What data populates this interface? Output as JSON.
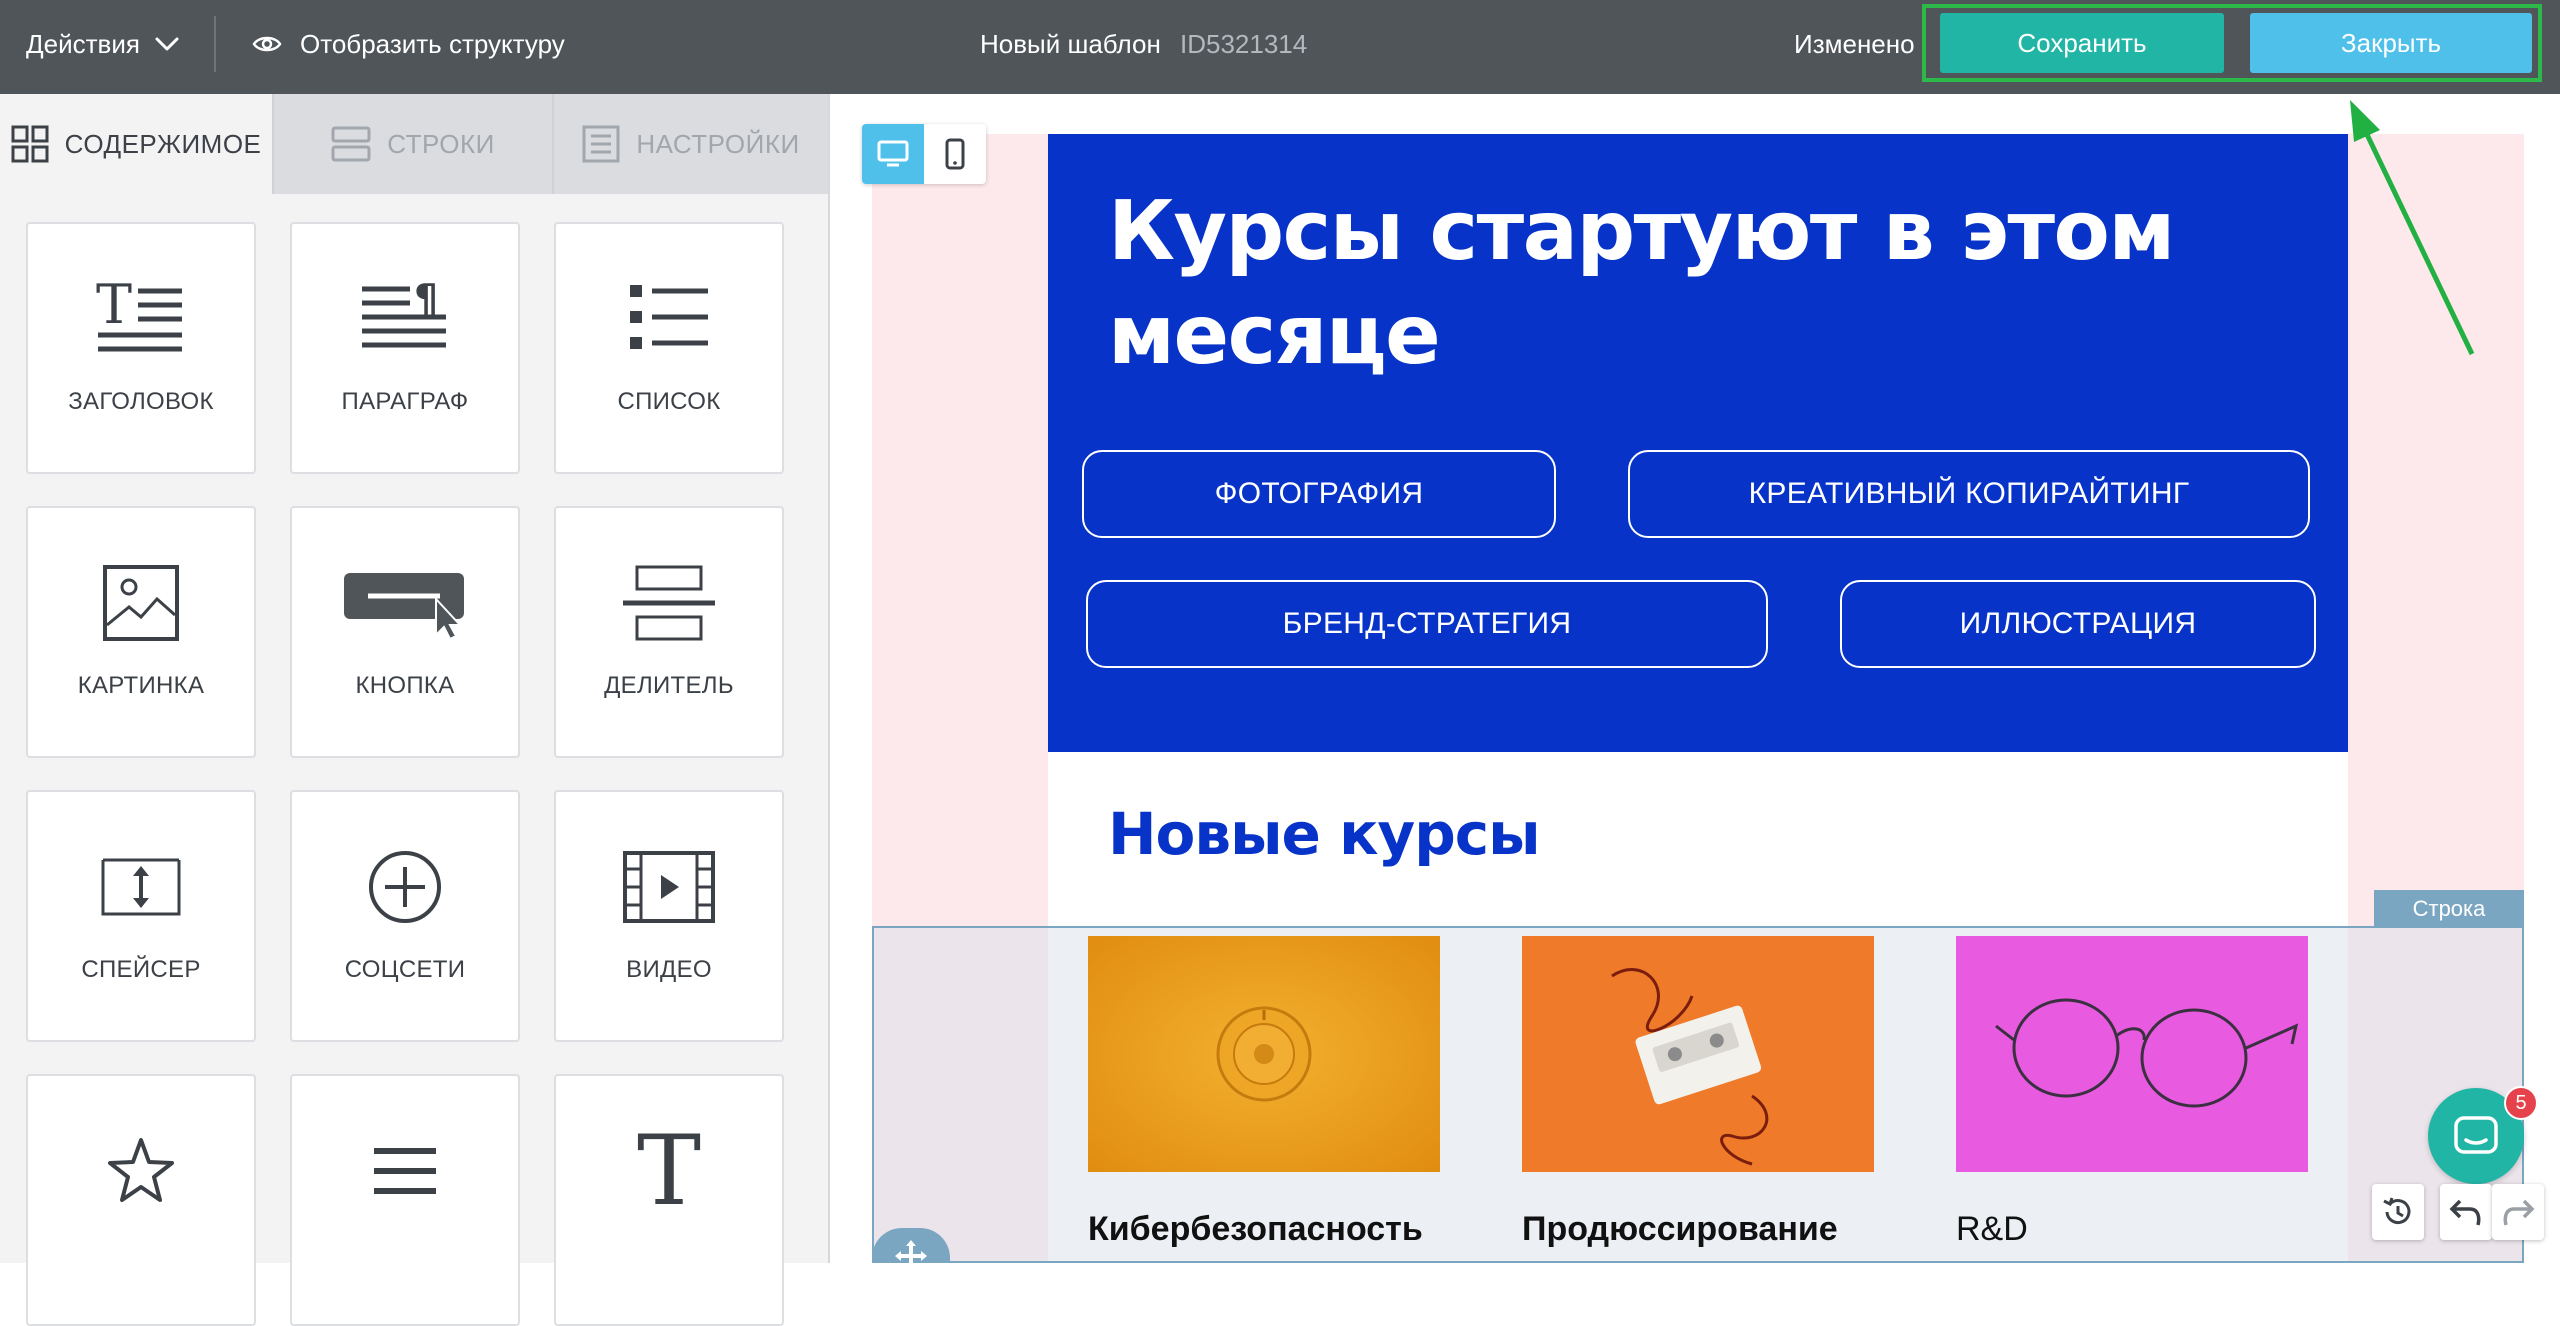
{
  "topbar": {
    "actions_label": "Действия",
    "structure_label": "Отобразить структуру",
    "template_name": "Новый шаблон",
    "template_id": "ID5321314",
    "status": "Изменено",
    "save_label": "Сохранить",
    "close_label": "Закрыть"
  },
  "tabs": {
    "content": "СОДЕРЖИМОЕ",
    "rows": "СТРОКИ",
    "settings": "НАСТРОЙКИ"
  },
  "blocks": [
    {
      "label": "ЗАГОЛОВОК",
      "icon": "heading-icon"
    },
    {
      "label": "ПАРАГРАФ",
      "icon": "paragraph-icon"
    },
    {
      "label": "СПИСОК",
      "icon": "list-icon"
    },
    {
      "label": "КАРТИНКА",
      "icon": "image-icon"
    },
    {
      "label": "КНОПКА",
      "icon": "button-icon"
    },
    {
      "label": "ДЕЛИТЕЛЬ",
      "icon": "divider-icon"
    },
    {
      "label": "СПЕЙСЕР",
      "icon": "spacer-icon"
    },
    {
      "label": "СОЦСЕТИ",
      "icon": "social-icon"
    },
    {
      "label": "ВИДЕО",
      "icon": "video-icon"
    },
    {
      "label": "",
      "icon": "star-icon"
    },
    {
      "label": "",
      "icon": "menu-icon"
    },
    {
      "label": "",
      "icon": "text-icon"
    }
  ],
  "email": {
    "hero_title": "Курсы стартуют в этом месяце",
    "pills": [
      "ФОТОГРАФИЯ",
      "КРЕАТИВНЫЙ КОПИРАЙТИНГ",
      "БРЕНД-СТРАТЕГИЯ",
      "ИЛЛЮСТРАЦИЯ"
    ],
    "section_title": "Новые курсы",
    "row_tag": "Строка",
    "courses": [
      "Кибербезопасность",
      "Продюссирование",
      "R&D"
    ]
  },
  "chat": {
    "badge_count": "5"
  },
  "colors": {
    "topbar": "#50555a",
    "save": "#21b5a5",
    "close": "#4ec0ea",
    "hero": "#0733c8",
    "highlight": "#2db84a",
    "row_outline": "#7aa6c2"
  }
}
